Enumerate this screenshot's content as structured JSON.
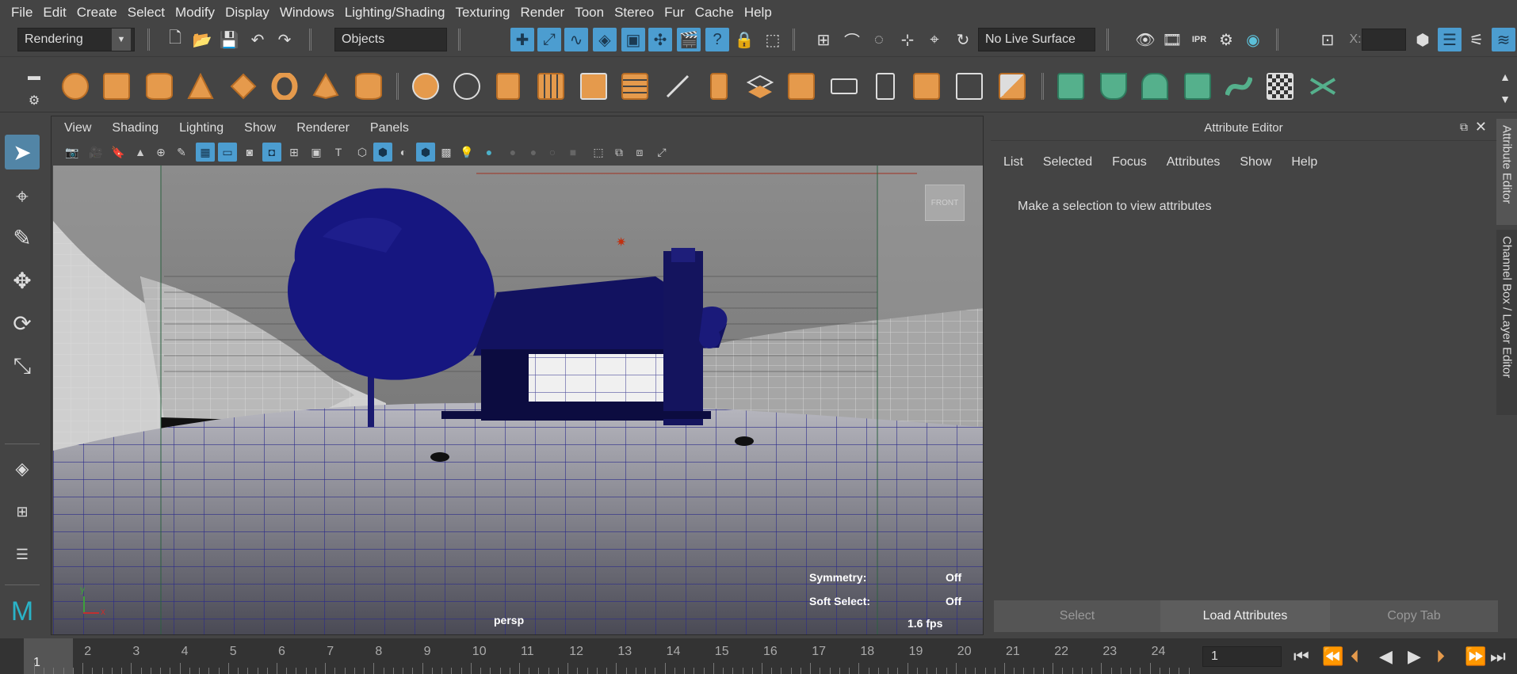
{
  "menubar": {
    "items": [
      "File",
      "Edit",
      "Create",
      "Select",
      "Modify",
      "Display",
      "Windows",
      "Lighting/Shading",
      "Texturing",
      "Render",
      "Toon",
      "Stereo",
      "Fur",
      "Cache",
      "Help"
    ]
  },
  "statusline": {
    "menuset": "Rendering",
    "selection_mode": "Objects",
    "live_surface": "No Live Surface",
    "x_label": "X:"
  },
  "viewport": {
    "menu": [
      "View",
      "Shading",
      "Lighting",
      "Show",
      "Renderer",
      "Panels"
    ],
    "camera_label": "persp",
    "view_cube_label": "FRONT",
    "hud": {
      "symmetry_label": "Symmetry:",
      "symmetry_value": "Off",
      "soft_select_label": "Soft Select:",
      "soft_select_value": "Off",
      "fps": "1.6 fps"
    },
    "axis": {
      "x": "x",
      "y": "y"
    }
  },
  "attribute_editor": {
    "title": "Attribute Editor",
    "menu": [
      "List",
      "Selected",
      "Focus",
      "Attributes",
      "Show",
      "Help"
    ],
    "message": "Make a selection to view attributes",
    "buttons": {
      "select": "Select",
      "load": "Load Attributes",
      "copy_tab": "Copy Tab"
    }
  },
  "side_tabs": [
    "Attribute Editor",
    "Channel Box / Layer Editor"
  ],
  "timeline": {
    "current_frame": "1",
    "ticks": [
      "1",
      "2",
      "3",
      "4",
      "5",
      "6",
      "7",
      "8",
      "9",
      "10",
      "11",
      "12",
      "13",
      "14",
      "15",
      "16",
      "17",
      "18",
      "19",
      "20",
      "21",
      "22",
      "23",
      "24"
    ],
    "frame_field": "1"
  },
  "colors": {
    "accent_blue": "#4c9dd0",
    "shelf_orange": "#e59a4c",
    "shelf_green": "#55b08c",
    "wireframe": "#1c1c8c"
  }
}
